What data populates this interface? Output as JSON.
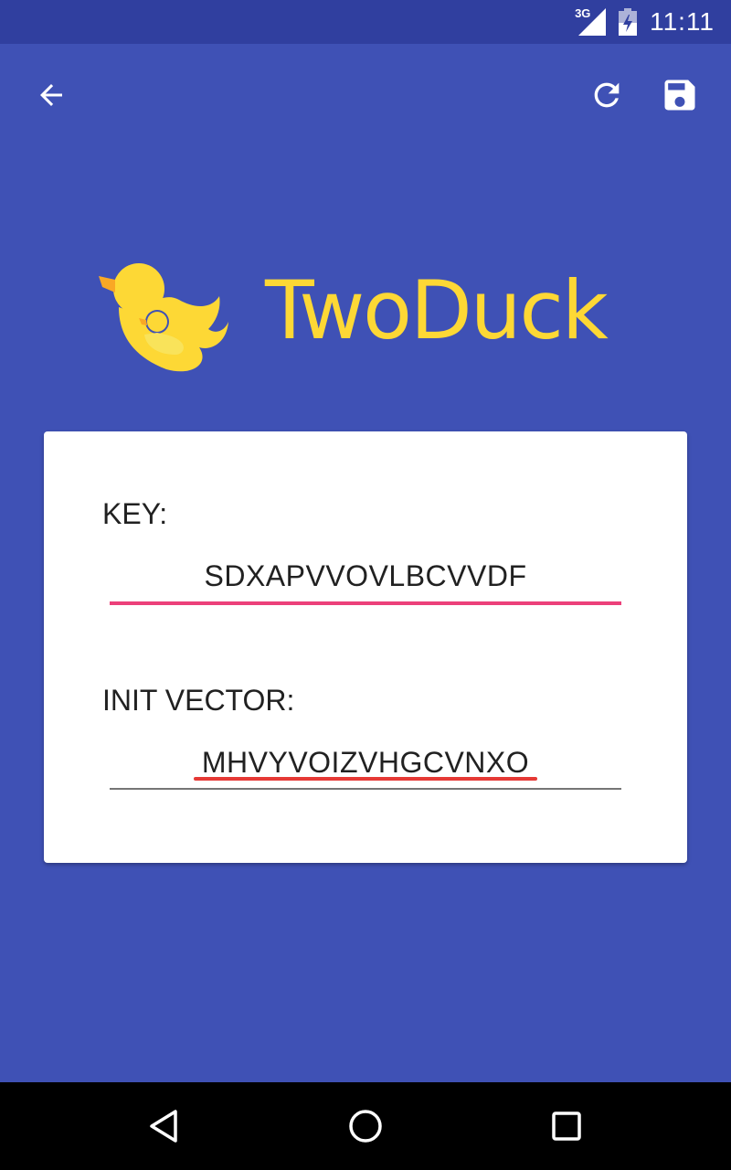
{
  "status_bar": {
    "network": "3G",
    "time": "11:11"
  },
  "toolbar": {
    "back_icon": "arrow-back-icon",
    "refresh_icon": "refresh-icon",
    "save_icon": "save-icon"
  },
  "logo": {
    "brand": "TwoDuck",
    "brand_color": "#FDD835"
  },
  "form": {
    "key": {
      "label": "KEY:",
      "value": "SDXAPVVOVLBCVVDF"
    },
    "init_vector": {
      "label": "INIT VECTOR:",
      "value": "MHVYVOIZVHGCVNXO"
    }
  },
  "colors": {
    "primary": "#3F51B5",
    "primary_dark": "#303F9F",
    "accent": "#EC407A",
    "spell_error": "#E53935"
  },
  "nav_bar": {
    "back_icon": "nav-back-icon",
    "home_icon": "nav-home-icon",
    "recents_icon": "nav-recents-icon"
  }
}
